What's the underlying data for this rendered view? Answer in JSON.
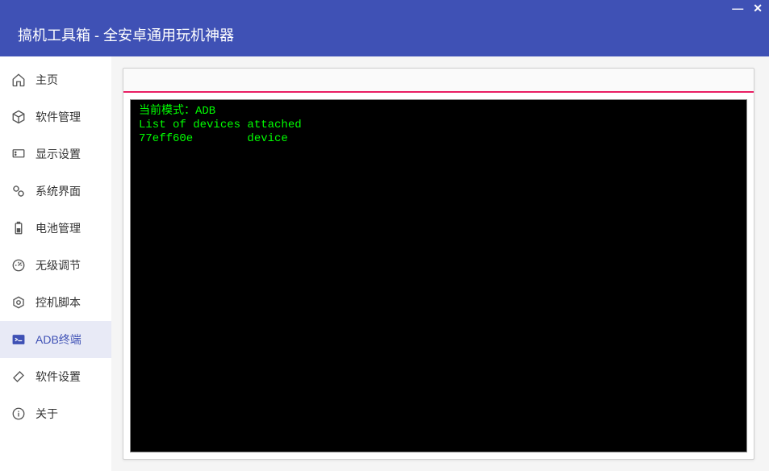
{
  "header": {
    "title": "搞机工具箱 - 全安卓通用玩机神器"
  },
  "sidebar": {
    "items": [
      {
        "id": "home",
        "label": "主页",
        "active": false
      },
      {
        "id": "software",
        "label": "软件管理",
        "active": false
      },
      {
        "id": "display",
        "label": "显示设置",
        "active": false
      },
      {
        "id": "system-ui",
        "label": "系统界面",
        "active": false
      },
      {
        "id": "battery",
        "label": "电池管理",
        "active": false
      },
      {
        "id": "sleepless",
        "label": "无级调节",
        "active": false
      },
      {
        "id": "scripts",
        "label": "控机脚本",
        "active": false
      },
      {
        "id": "adb-terminal",
        "label": "ADB终端",
        "active": true
      },
      {
        "id": "settings",
        "label": "软件设置",
        "active": false
      },
      {
        "id": "about",
        "label": "关于",
        "active": false
      }
    ]
  },
  "terminal": {
    "lines": [
      "当前模式：ADB",
      "List of devices attached",
      "77eff60e        device"
    ]
  }
}
